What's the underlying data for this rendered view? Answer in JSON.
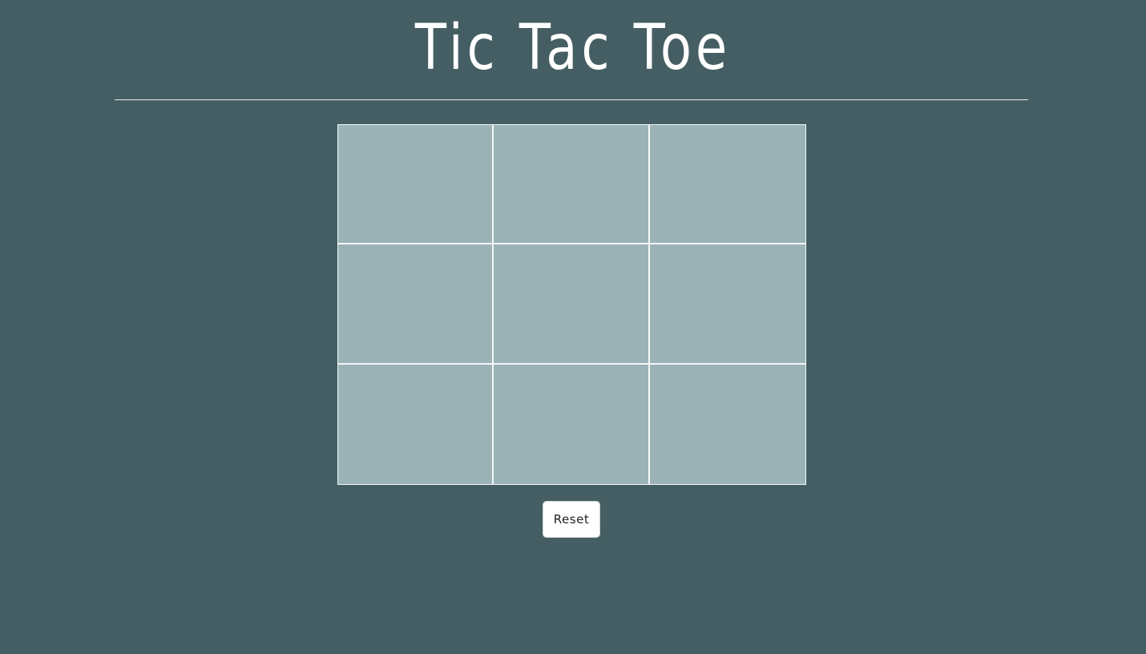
{
  "header": {
    "title": "Tic Tac Toe"
  },
  "board": {
    "cells": [
      "",
      "",
      "",
      "",
      "",
      "",
      "",
      "",
      ""
    ]
  },
  "controls": {
    "reset_label": "Reset"
  },
  "colors": {
    "background": "#455e63",
    "cell": "#9bb3b7",
    "grid_lines": "#f4f7f7",
    "title_text": "#ffffff",
    "button_bg": "#ffffff"
  }
}
